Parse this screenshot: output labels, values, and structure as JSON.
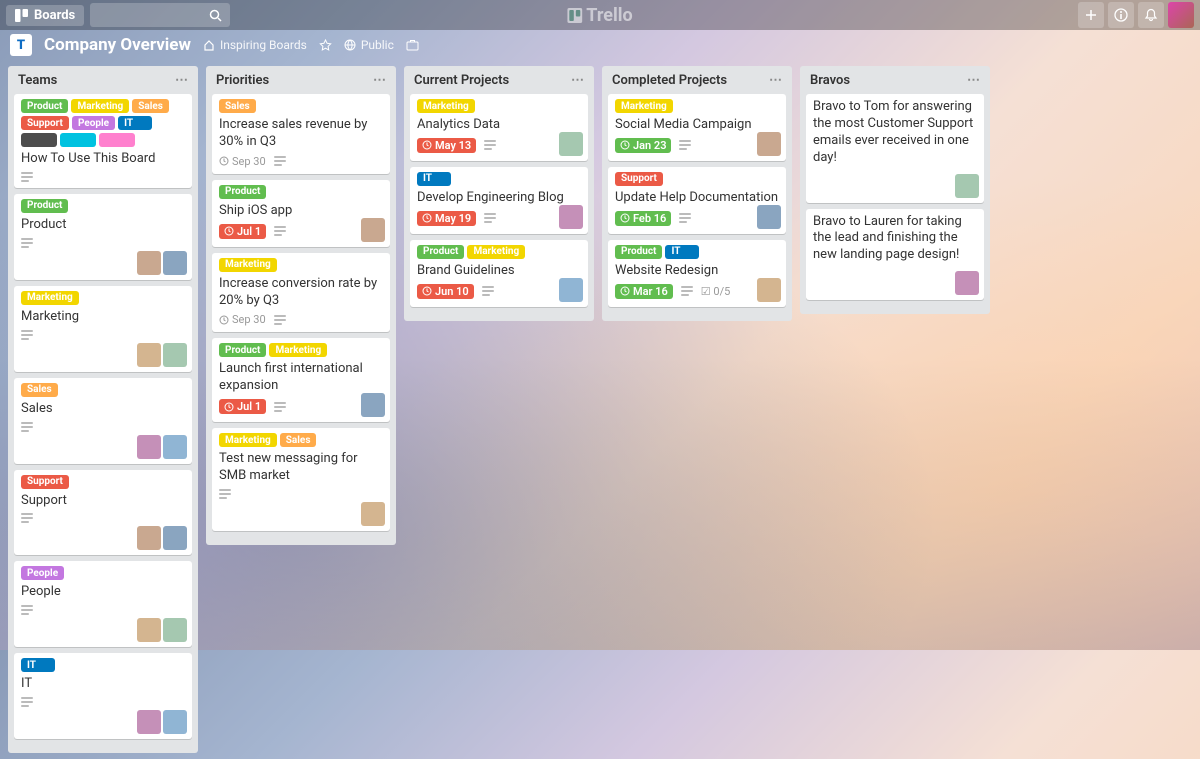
{
  "topbar": {
    "boards": "Boards",
    "logo": "Trello"
  },
  "board": {
    "title": "Company Overview",
    "inspiring": "Inspiring Boards",
    "public": "Public"
  },
  "labels": {
    "product": "Product",
    "marketing": "Marketing",
    "sales": "Sales",
    "support": "Support",
    "people": "People",
    "it": "IT"
  },
  "lists": [
    {
      "name": "Teams",
      "cards": [
        {
          "labels": [
            [
              "c-green",
              "product"
            ],
            [
              "c-yellow",
              "marketing"
            ],
            [
              "c-orange",
              "sales"
            ],
            [
              "c-red",
              "support"
            ],
            [
              "c-purple",
              "people"
            ],
            [
              "c-blue",
              "it"
            ],
            [
              "c-black",
              ""
            ],
            [
              "c-sky",
              ""
            ],
            [
              "c-pink",
              ""
            ]
          ],
          "title": "How To Use This Board",
          "desc": true
        },
        {
          "labels": [
            [
              "c-green",
              "product"
            ]
          ],
          "title": "Product",
          "desc": true,
          "members": 2
        },
        {
          "labels": [
            [
              "c-yellow",
              "marketing"
            ]
          ],
          "title": "Marketing",
          "desc": true,
          "members": 2
        },
        {
          "labels": [
            [
              "c-orange",
              "sales"
            ]
          ],
          "title": "Sales",
          "desc": true,
          "members": 2
        },
        {
          "labels": [
            [
              "c-red",
              "support"
            ]
          ],
          "title": "Support",
          "desc": true,
          "members": 2
        },
        {
          "labels": [
            [
              "c-purple",
              "people"
            ]
          ],
          "title": "People",
          "desc": true,
          "members": 2
        },
        {
          "labels": [
            [
              "c-blue",
              "it"
            ]
          ],
          "title": "IT",
          "desc": true,
          "members": 2
        }
      ]
    },
    {
      "name": "Priorities",
      "cards": [
        {
          "labels": [
            [
              "c-orange",
              "sales"
            ]
          ],
          "title": "Increase sales revenue by 30% in Q3",
          "due": "Sep 30",
          "dueColor": "",
          "desc": true
        },
        {
          "labels": [
            [
              "c-green",
              "product"
            ]
          ],
          "title": "Ship iOS app",
          "due": "Jul 1",
          "dueColor": "due-red",
          "desc": true,
          "members": 1
        },
        {
          "labels": [
            [
              "c-yellow",
              "marketing"
            ]
          ],
          "title": "Increase conversion rate by 20% by Q3",
          "due": "Sep 30",
          "dueColor": "",
          "desc": true
        },
        {
          "labels": [
            [
              "c-green",
              "product"
            ],
            [
              "c-yellow",
              "marketing"
            ]
          ],
          "title": "Launch first international expansion",
          "due": "Jul 1",
          "dueColor": "due-red",
          "desc": true,
          "members": 1
        },
        {
          "labels": [
            [
              "c-yellow",
              "marketing"
            ],
            [
              "c-orange",
              "sales"
            ]
          ],
          "title": "Test new messaging for SMB market",
          "desc": true,
          "members": 1
        }
      ]
    },
    {
      "name": "Current Projects",
      "cards": [
        {
          "labels": [
            [
              "c-yellow",
              "marketing"
            ]
          ],
          "title": "Analytics Data",
          "due": "May 13",
          "dueColor": "due-red",
          "desc": true,
          "members": 1
        },
        {
          "labels": [
            [
              "c-blue",
              "it"
            ]
          ],
          "title": "Develop Engineering Blog",
          "due": "May 19",
          "dueColor": "due-red",
          "desc": true,
          "members": 1
        },
        {
          "labels": [
            [
              "c-green",
              "product"
            ],
            [
              "c-yellow",
              "marketing"
            ]
          ],
          "title": "Brand Guidelines",
          "due": "Jun 10",
          "dueColor": "due-red",
          "desc": true,
          "members": 1
        }
      ]
    },
    {
      "name": "Completed Projects",
      "cards": [
        {
          "labels": [
            [
              "c-yellow",
              "marketing"
            ]
          ],
          "title": "Social Media Campaign",
          "due": "Jan 23",
          "dueColor": "due-green",
          "desc": true,
          "members": 1
        },
        {
          "labels": [
            [
              "c-red",
              "support"
            ]
          ],
          "title": "Update Help Documentation",
          "due": "Feb 16",
          "dueColor": "due-green",
          "desc": true,
          "members": 1
        },
        {
          "labels": [
            [
              "c-green",
              "product"
            ],
            [
              "c-blue",
              "it"
            ]
          ],
          "title": "Website Redesign",
          "due": "Mar 16",
          "dueColor": "due-green",
          "desc": true,
          "checklist": "0/5",
          "members": 1
        }
      ]
    },
    {
      "name": "Bravos",
      "cards": [
        {
          "title": "Bravo to Tom for answering the most Customer Support emails ever received in one day!",
          "members": 1
        },
        {
          "title": "Bravo to Lauren for taking the lead and finishing the new landing page design!",
          "members": 1
        }
      ]
    }
  ]
}
